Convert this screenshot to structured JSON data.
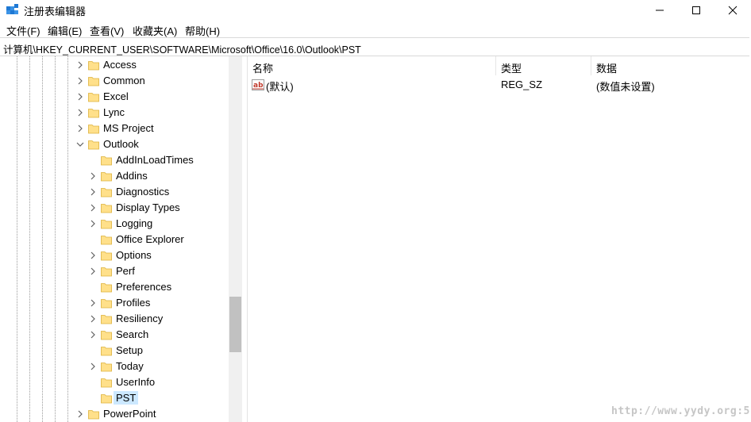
{
  "window": {
    "title": "注册表编辑器"
  },
  "menu": [
    {
      "label": "文件(F)"
    },
    {
      "label": "编辑(E)"
    },
    {
      "label": "查看(V)"
    },
    {
      "label": "收藏夹(A)"
    },
    {
      "label": "帮助(H)"
    }
  ],
  "address": {
    "path": "计算机\\HKEY_CURRENT_USER\\SOFTWARE\\Microsoft\\Office\\16.0\\Outlook\\PST"
  },
  "tree": {
    "items": [
      {
        "label": "Access",
        "expanded": false,
        "has_children": true
      },
      {
        "label": "Common",
        "expanded": false,
        "has_children": true
      },
      {
        "label": "Excel",
        "expanded": false,
        "has_children": true
      },
      {
        "label": "Lync",
        "expanded": false,
        "has_children": true
      },
      {
        "label": "MS Project",
        "expanded": false,
        "has_children": true
      },
      {
        "label": "Outlook",
        "expanded": true,
        "has_children": true
      },
      {
        "label": "AddInLoadTimes",
        "expanded": false,
        "has_children": false
      },
      {
        "label": "Addins",
        "expanded": false,
        "has_children": true
      },
      {
        "label": "Diagnostics",
        "expanded": false,
        "has_children": true
      },
      {
        "label": "Display Types",
        "expanded": false,
        "has_children": true
      },
      {
        "label": "Logging",
        "expanded": false,
        "has_children": true
      },
      {
        "label": "Office Explorer",
        "expanded": false,
        "has_children": false
      },
      {
        "label": "Options",
        "expanded": false,
        "has_children": true
      },
      {
        "label": "Perf",
        "expanded": false,
        "has_children": true
      },
      {
        "label": "Preferences",
        "expanded": false,
        "has_children": false
      },
      {
        "label": "Profiles",
        "expanded": false,
        "has_children": true
      },
      {
        "label": "Resiliency",
        "expanded": false,
        "has_children": true
      },
      {
        "label": "Search",
        "expanded": false,
        "has_children": true
      },
      {
        "label": "Setup",
        "expanded": false,
        "has_children": false
      },
      {
        "label": "Today",
        "expanded": false,
        "has_children": true
      },
      {
        "label": "UserInfo",
        "expanded": false,
        "has_children": false
      },
      {
        "label": "PST",
        "expanded": false,
        "has_children": false,
        "selected": true
      },
      {
        "label": "PowerPoint",
        "expanded": false,
        "has_children": true
      }
    ]
  },
  "list": {
    "columns": [
      {
        "label": "名称"
      },
      {
        "label": "类型"
      },
      {
        "label": "数据"
      }
    ],
    "rows": [
      {
        "name": "(默认)",
        "type": "REG_SZ",
        "data": "(数值未设置)",
        "icon": "string-value-icon"
      }
    ]
  },
  "watermark": {
    "text": "http://www.yydy.org:5"
  },
  "colors": {
    "selection": "#cce8ff",
    "folder": "#ffe08a",
    "folder_edge": "#dcb13a",
    "string_icon": "#c0392b"
  }
}
